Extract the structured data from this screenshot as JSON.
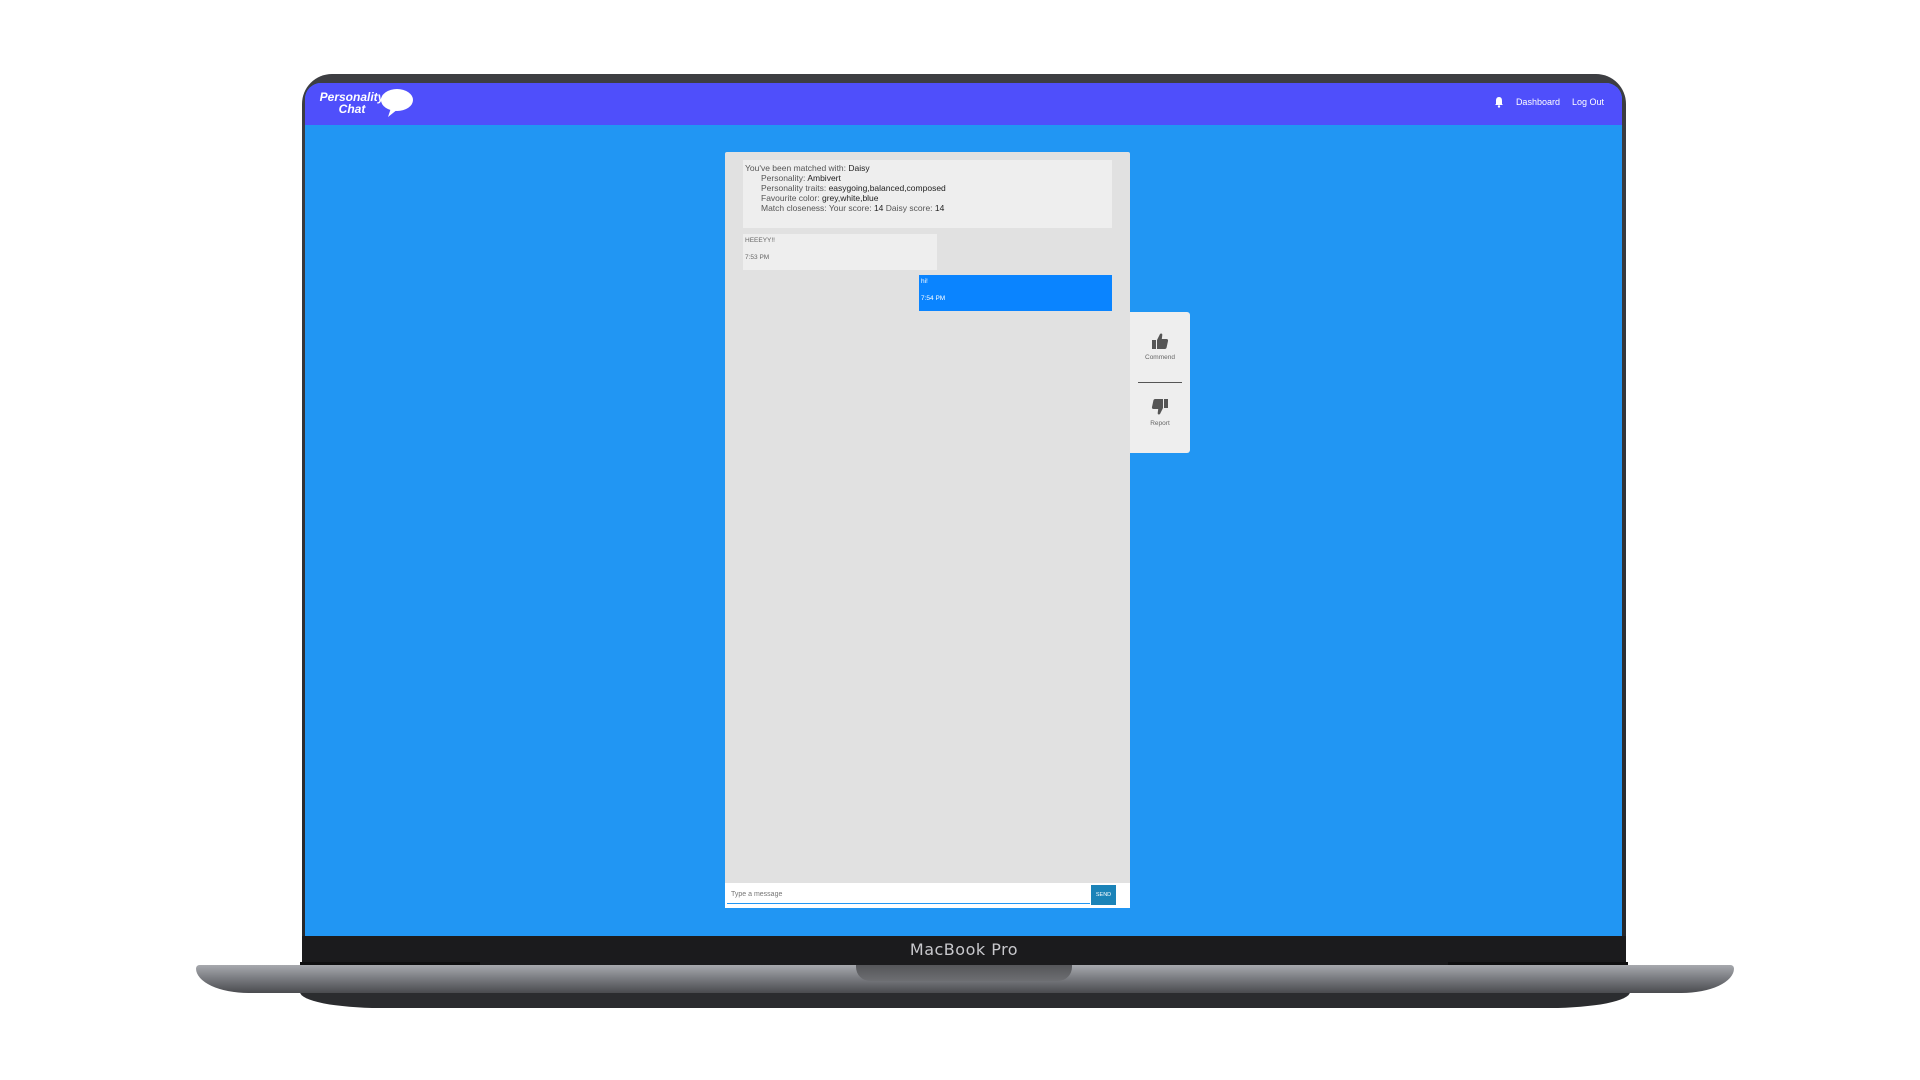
{
  "device": {
    "label": "MacBook Pro"
  },
  "navbar": {
    "logo_line1": "Personality",
    "logo_line2": "Chat",
    "dashboard_label": "Dashboard",
    "logout_label": "Log Out",
    "icons": [
      "bell-icon",
      "speech-bubble-icon"
    ]
  },
  "match": {
    "intro": "You've been matched with:",
    "name": "Daisy",
    "personality_label": "Personality:",
    "personality": "Ambivert",
    "traits_label": "Personality traits:",
    "traits": "easygoing,balanced,composed",
    "color_label": "Favourite color:",
    "color": "grey,white,blue",
    "closeness_label": "Match closeness: Your score:",
    "your_score": "14",
    "other_score_label": "Daisy score:",
    "other_score": "14"
  },
  "messages": [
    {
      "direction": "in",
      "text": "HEEEYY!!",
      "time": "7:53 PM"
    },
    {
      "direction": "out",
      "text": "hi!",
      "time": "7:54 PM"
    }
  ],
  "composer": {
    "placeholder": "Type a message",
    "send_label": "SEND"
  },
  "actions": {
    "commend_label": "Commend",
    "report_label": "Report"
  },
  "colors": {
    "navbar": "#4f4ffb",
    "background": "#2196f3",
    "outgoing_bubble": "#0a84ff",
    "send_button": "#1b83b8"
  }
}
